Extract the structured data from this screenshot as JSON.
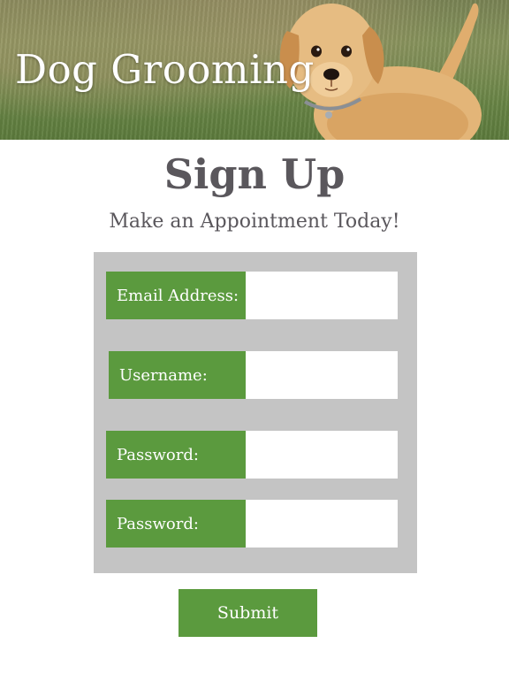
{
  "header": {
    "site_title": "Dog Grooming"
  },
  "main": {
    "title": "Sign Up",
    "subtitle": "Make an Appointment Today!"
  },
  "form": {
    "fields": [
      {
        "label": "Email Address:",
        "value": "",
        "placeholder": ""
      },
      {
        "label": "Username:",
        "value": "",
        "placeholder": ""
      },
      {
        "label": "Password:",
        "value": "",
        "placeholder": ""
      },
      {
        "label": "Password:",
        "value": "",
        "placeholder": ""
      }
    ],
    "submit_label": "Submit"
  },
  "colors": {
    "accent_green": "#5b9a3e",
    "panel_gray": "#c4c4c4",
    "heading_text": "#5a575c"
  }
}
